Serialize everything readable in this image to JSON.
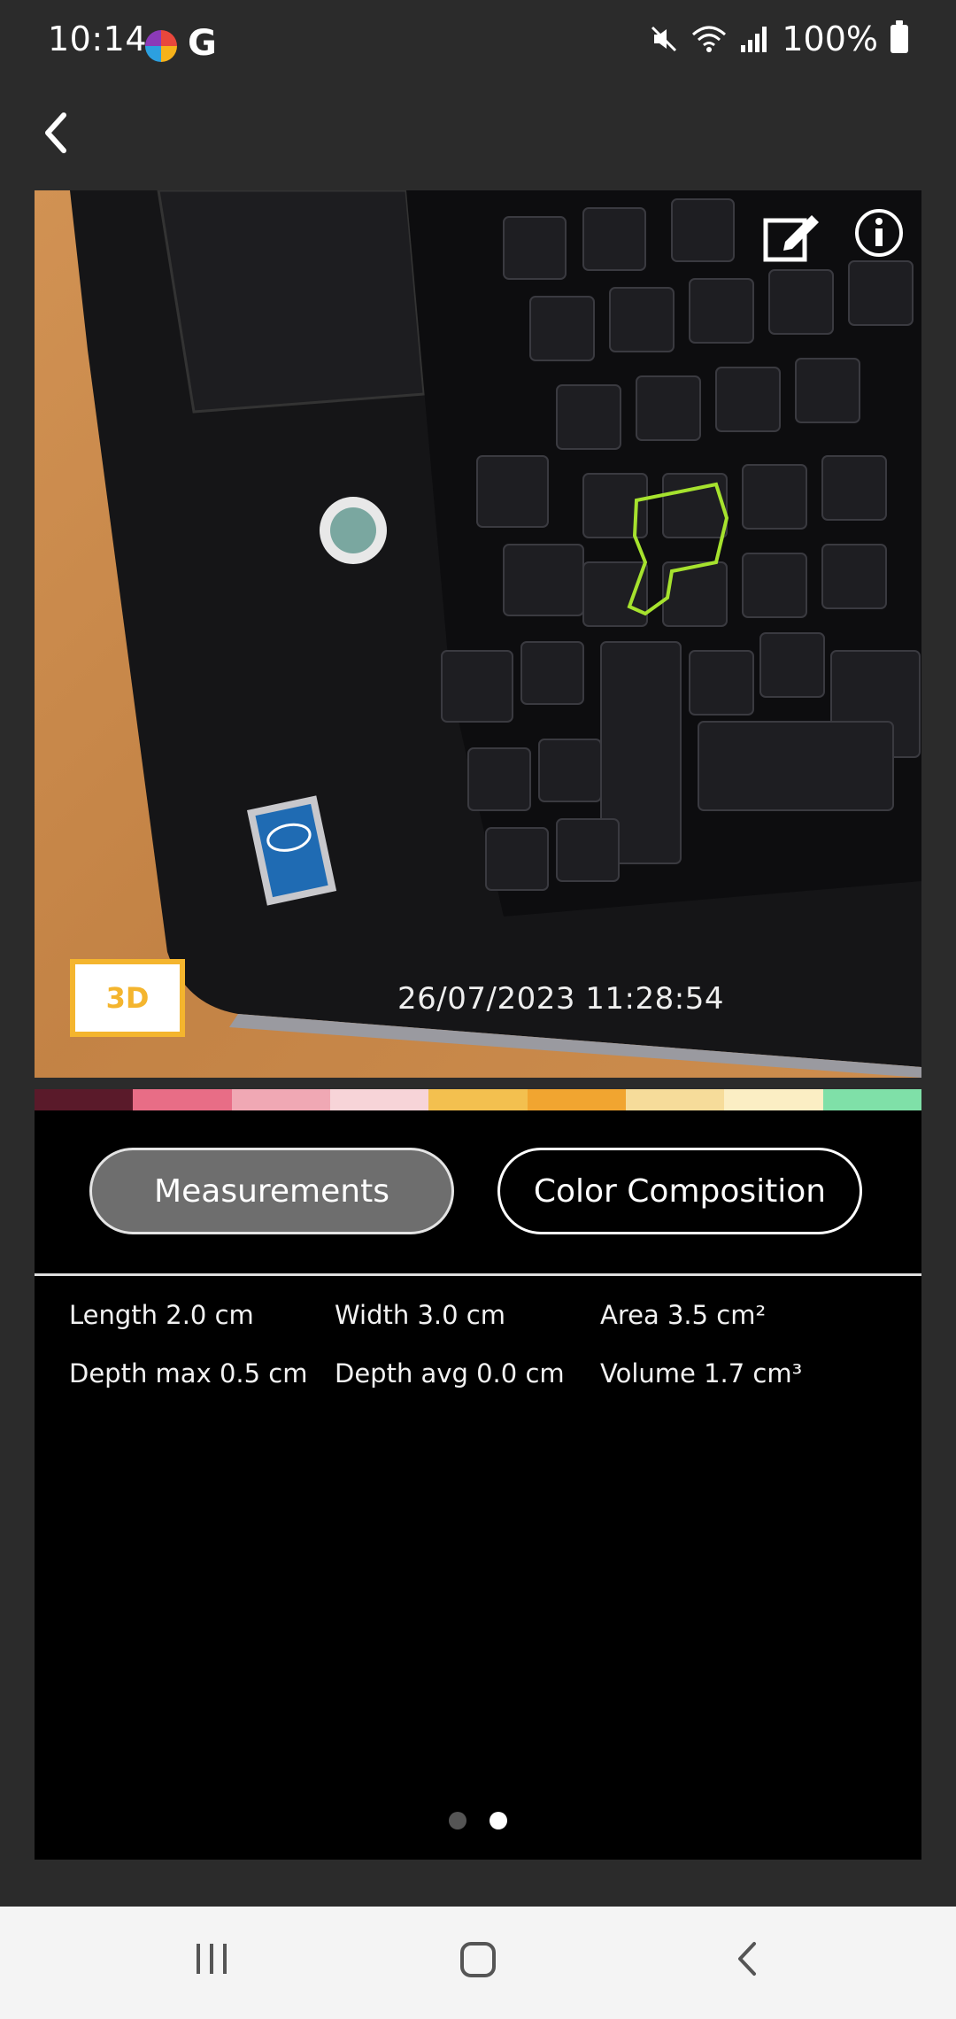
{
  "status_bar": {
    "time": "10:14",
    "google_letter": "G",
    "battery_text": "100%"
  },
  "photo": {
    "badge": "3D",
    "timestamp": "26/07/2023 11:28:54"
  },
  "color_strip": [
    "#5a1a2a",
    "#e86d86",
    "#f0a8b4",
    "#f7d4d8",
    "#f3c04f",
    "#f1a530",
    "#f6dc9a",
    "#fbeec4",
    "#7fe0a8"
  ],
  "tabs": [
    {
      "label": "Measurements",
      "active": true
    },
    {
      "label": "Color Composition",
      "active": false
    }
  ],
  "measurements": [
    "Length 2.0 cm",
    "Width 3.0 cm",
    "Area 3.5 cm²",
    "Depth max 0.5 cm",
    "Depth avg 0.0 cm",
    "Volume 1.7 cm³"
  ],
  "pager": {
    "page": 2,
    "total": 2
  }
}
